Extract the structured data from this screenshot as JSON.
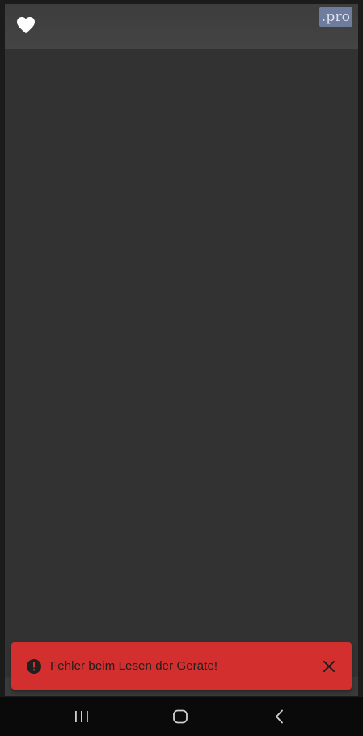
{
  "header": {
    "favorite_icon": "heart-icon",
    "pro_badge": ".pro"
  },
  "snackbar": {
    "message": "Fehler beim Lesen der Geräte!",
    "status_icon": "error-icon",
    "close_icon": "close-icon",
    "color": "#d32f2f"
  },
  "nav": {
    "recents_icon": "recents-icon",
    "home_icon": "home-icon",
    "back_icon": "back-icon"
  },
  "colors": {
    "background": "#323232",
    "header": "#424242",
    "pro_badge": "#6e7c9e"
  }
}
